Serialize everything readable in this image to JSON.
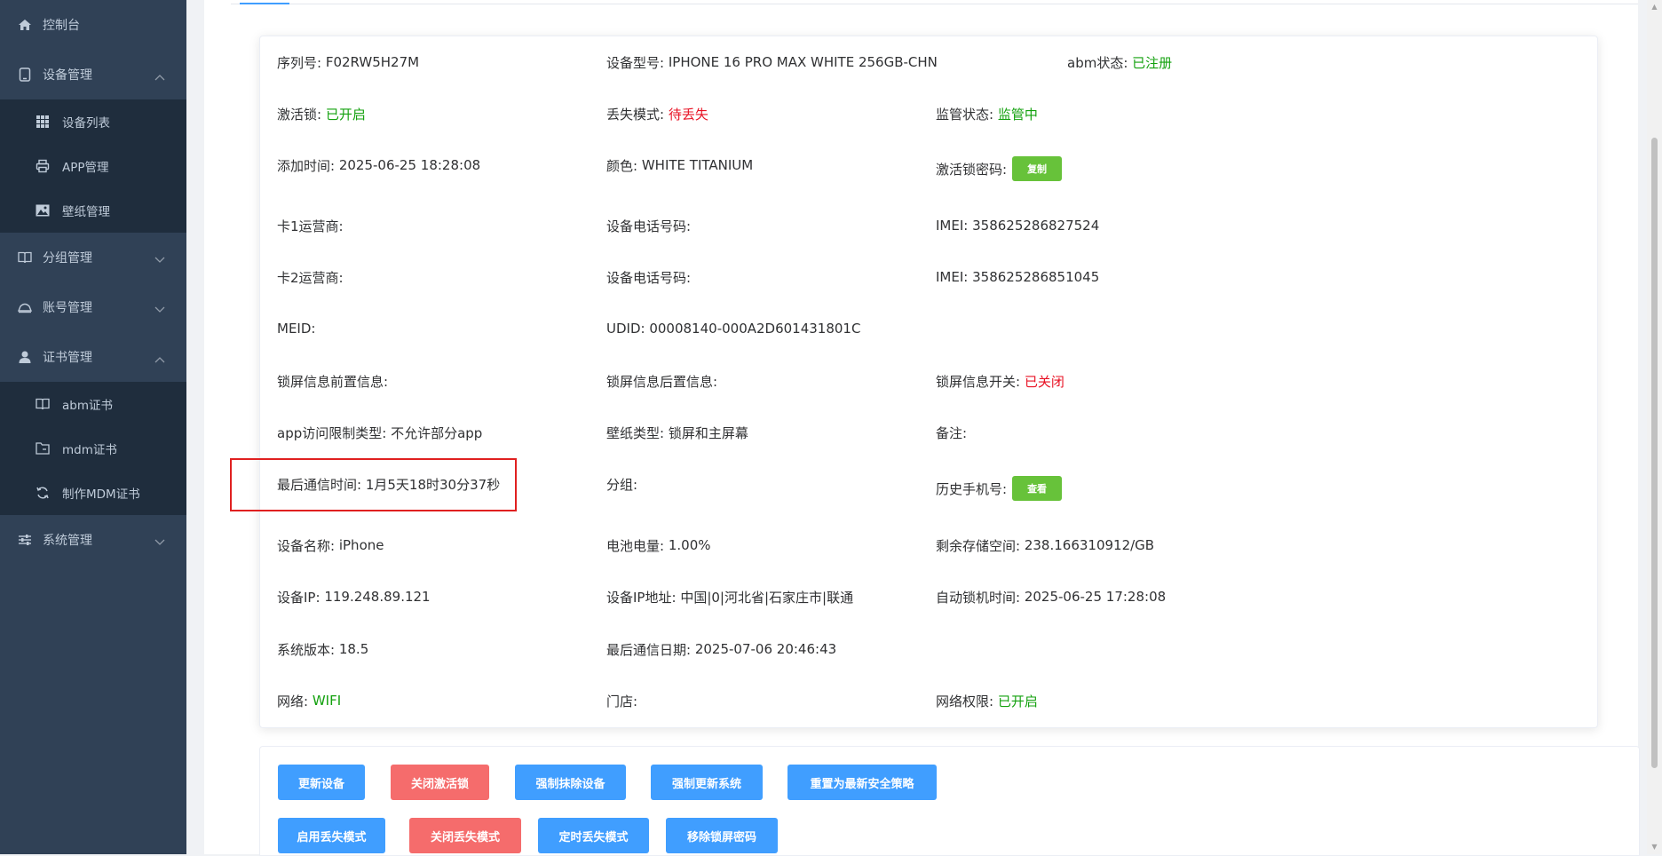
{
  "sidebar": {
    "items": [
      {
        "label": "控制台",
        "icon": "home-icon"
      },
      {
        "label": "设备管理",
        "icon": "tablet-icon",
        "expanded": true,
        "children": [
          {
            "label": "设备列表",
            "icon": "grid-icon"
          },
          {
            "label": "APP管理",
            "icon": "printer-icon"
          },
          {
            "label": "壁纸管理",
            "icon": "picture-icon"
          }
        ]
      },
      {
        "label": "分组管理",
        "icon": "book-icon",
        "expanded": false
      },
      {
        "label": "账号管理",
        "icon": "cloud-icon",
        "expanded": false
      },
      {
        "label": "证书管理",
        "icon": "user-icon",
        "expanded": true,
        "children": [
          {
            "label": "abm证书",
            "icon": "book-icon"
          },
          {
            "label": "mdm证书",
            "icon": "folder-icon"
          },
          {
            "label": "制作MDM证书",
            "icon": "refresh-icon"
          }
        ]
      },
      {
        "label": "系统管理",
        "icon": "sliders-icon",
        "expanded": false
      }
    ]
  },
  "device": {
    "serial_label": "序列号:",
    "serial": "F02RW5H27M",
    "model_label": "设备型号:",
    "model": "IPHONE 16 PRO MAX WHITE 256GB-CHN",
    "abm_label": "abm状态:",
    "abm": "已注册",
    "activation_lock_label": "激活锁:",
    "activation_lock": "已开启",
    "lost_mode_label": "丢失模式:",
    "lost_mode": "待丢失",
    "supervise_label": "监管状态:",
    "supervise": "监管中",
    "added_time_label": "添加时间:",
    "added_time": "2025-06-25 18:28:08",
    "color_label": "颜色:",
    "color": "WHITE TITANIUM",
    "lock_pwd_label": "激活锁密码:",
    "copy_btn": "复制",
    "sim1_label": "卡1运营商:",
    "phone1_label": "设备电话号码:",
    "imei1_label": "IMEI:",
    "imei1": "358625286827524",
    "sim2_label": "卡2运营商:",
    "phone2_label": "设备电话号码:",
    "imei2_label": "IMEI:",
    "imei2": "358625286851045",
    "meid_label": "MEID:",
    "udid_label": "UDID:",
    "udid": "00008140-000A2D601431801C",
    "lock_pre_label": "锁屏信息前置信息:",
    "lock_post_label": "锁屏信息后置信息:",
    "lock_switch_label": "锁屏信息开关:",
    "lock_switch": "已关闭",
    "app_limit_label": "app访问限制类型:",
    "app_limit": "不允许部分app",
    "wallpaper_label": "壁纸类型:",
    "wallpaper": "锁屏和主屏幕",
    "remark_label": "备注:",
    "last_comm_label": "最后通信时间:",
    "last_comm": "1月5天18时30分37秒",
    "group_label": "分组:",
    "history_phone_label": "历史手机号:",
    "view_btn": "查看",
    "name_label": "设备名称:",
    "name": "iPhone",
    "battery_label": "电池电量:",
    "battery": "1.00%",
    "storage_label": "剩余存储空间:",
    "storage": "238.166310912/GB",
    "ip_label": "设备IP:",
    "ip": "119.248.89.121",
    "ip_addr_label": "设备IP地址:",
    "ip_addr": "中国|0|河北省|石家庄市|联通",
    "autolock_label": "自动锁机时间:",
    "autolock": "2025-06-25 17:28:08",
    "os_label": "系统版本:",
    "os": "18.5",
    "last_date_label": "最后通信日期:",
    "last_date": "2025-07-06 20:46:43",
    "network_label": "网络:",
    "network": "WIFI",
    "store_label": "门店:",
    "net_perm_label": "网络权限:",
    "net_perm": "已开启"
  },
  "actions": {
    "row1": [
      "更新设备",
      "关闭激活锁",
      "强制抹除设备",
      "强制更新系统",
      "重置为最新安全策略"
    ],
    "row2": [
      "启用丢失模式",
      "关闭丢失模式",
      "定时丢失模式",
      "移除锁屏密码"
    ]
  },
  "colors": {
    "sidebar_bg": "#304156",
    "submenu_bg": "#1f2d3d",
    "primary": "#409eff",
    "danger": "#f56c6c",
    "success": "#67c23a",
    "status_green": "#13a10e",
    "status_red": "#e81123"
  }
}
